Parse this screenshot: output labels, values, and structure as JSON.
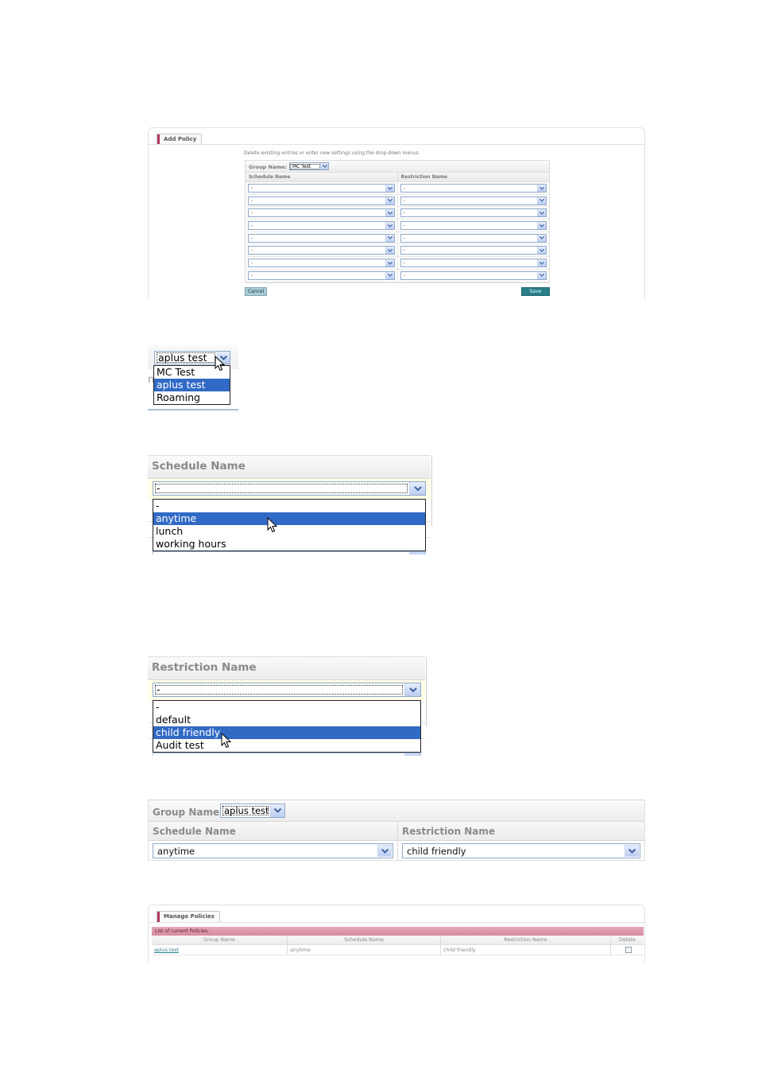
{
  "add_policy": {
    "tab_label": "Add Policy",
    "hint": "Delete existing entries or enter new settings using the drop-down menus",
    "group_name_label": "Group Name:",
    "group_name_value": "MC Test",
    "columns": [
      "Schedule Name",
      "Restriction Name"
    ],
    "rows": [
      {
        "schedule": "-",
        "restriction": "-"
      },
      {
        "schedule": "-",
        "restriction": "-"
      },
      {
        "schedule": "-",
        "restriction": "-"
      },
      {
        "schedule": "-",
        "restriction": "-"
      },
      {
        "schedule": "-",
        "restriction": "-"
      },
      {
        "schedule": "-",
        "restriction": "-"
      },
      {
        "schedule": "-",
        "restriction": "-"
      },
      {
        "schedule": "-",
        "restriction": "-"
      }
    ],
    "cancel_label": "Cancel",
    "save_label": "Save"
  },
  "group_dropdown": {
    "ghost_text": "n",
    "selected": "aplus test",
    "options": [
      "MC Test",
      "aplus test",
      "Roaming"
    ],
    "highlighted_index": 1
  },
  "schedule_dropdown": {
    "header": "Schedule Name",
    "selected": "-",
    "options": [
      "-",
      "anytime",
      "lunch",
      "working hours"
    ],
    "highlighted_index": 1
  },
  "restriction_dropdown": {
    "header": "Restriction Name",
    "selected": "-",
    "options": [
      "-",
      "default",
      "child friendly",
      "Audit test"
    ],
    "highlighted_index": 2
  },
  "result_form": {
    "group_name_label": "Group Name:",
    "group_name_value": "aplus test",
    "schedule_header": "Schedule Name",
    "restriction_header": "Restriction Name",
    "schedule_value": "anytime",
    "restriction_value": "child friendly"
  },
  "manage_policies": {
    "tab_label": "Manage Policies",
    "list_title": "List of current Policies:",
    "columns": [
      "Group Name",
      "Schedule Name",
      "Restriction Name",
      "Delete"
    ],
    "rows": [
      {
        "group": "aplus test",
        "schedule": "anytime",
        "restriction": "child friendly",
        "delete": false
      }
    ]
  },
  "colors": {
    "accent_tab": "#b0385c",
    "highlight": "#316ac5",
    "save_button": "#2a7e8a",
    "cancel_button": "#a9cbd6",
    "list_header_pink": "#d68a9f",
    "link": "#2c7e92"
  }
}
